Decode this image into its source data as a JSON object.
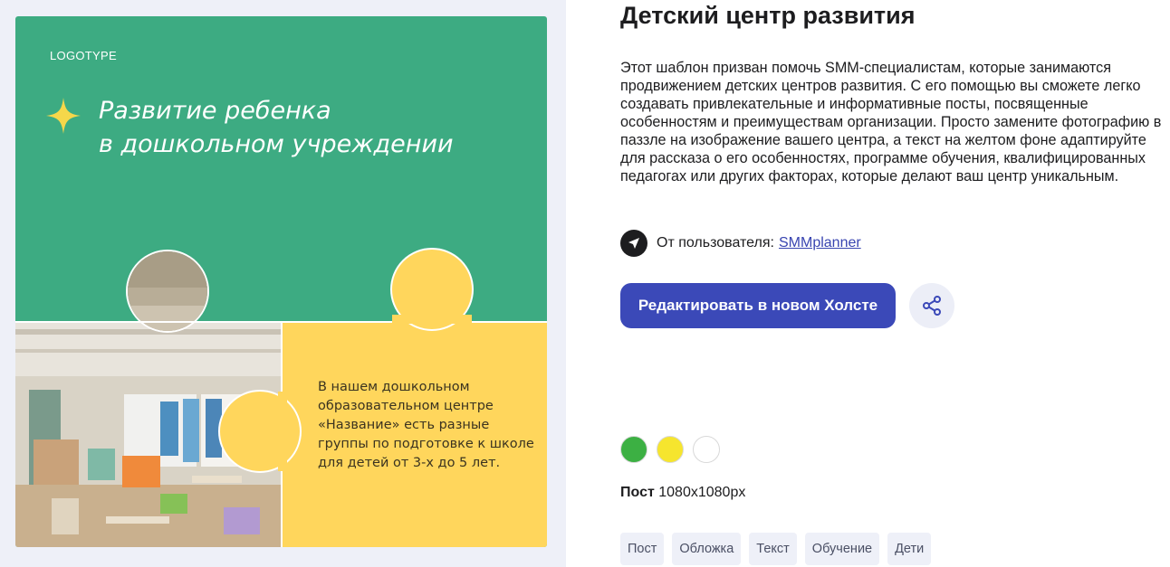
{
  "preview": {
    "logo": "LOGOTYPE",
    "headline_line1": "Развитие ребенка",
    "headline_line2": "в дошкольном учреждении",
    "puzzle_text": "В нашем дошкольном образовательном центре «Название» есть разные группы по подготовке к школе для детей от 3-х до 5 лет."
  },
  "info": {
    "title": "Детский центр развития",
    "description": "Этот шаблон призван помочь SMM-специалистам, которые занимаются продвижением детских центров развития. С его помощью вы сможете легко создавать привлекательные и информативные посты, посвященные особенностям и преимуществам организации. Просто замените фотографию в паззле на изображение вашего центра, а текст на желтом фоне адаптируйте для рассказа о его особенностях, программе обучения, квалифицированных педагогах или других факторах, которые делают ваш центр уникальным.",
    "author_prefix": "От пользователя:",
    "author_name": "SMMplanner",
    "edit_button": "Редактировать в новом Холсте",
    "size_label": "Пост",
    "size_value": "1080x1080px"
  },
  "colors": [
    "#3cb043",
    "#f6e52e",
    "#ffffff"
  ],
  "tags": [
    "Пост",
    "Обложка",
    "Текст",
    "Обучение",
    "Дети"
  ],
  "icons": {
    "author": "paper-plane-icon",
    "share": "share-icon",
    "headline": "sparkle-icon"
  }
}
